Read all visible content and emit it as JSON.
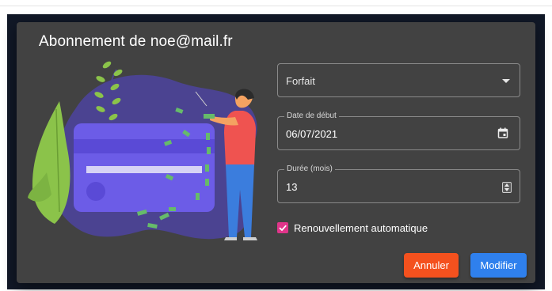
{
  "dialog": {
    "title": "Abonnement de noe@mail.fr"
  },
  "form": {
    "plan": {
      "placeholder": "Forfait",
      "icon": "chevron-down-icon"
    },
    "start_date": {
      "label": "Date de début",
      "value": "06/07/2021",
      "icon": "calendar-icon"
    },
    "duration": {
      "label": "Durée (mois)",
      "value": "13",
      "icon": "spinner-icon"
    },
    "auto_renew": {
      "label": "Renouvellement automatique",
      "checked": true
    }
  },
  "actions": {
    "cancel_label": "Annuler",
    "submit_label": "Modifier"
  },
  "colors": {
    "dialog_bg": "#424242",
    "backdrop": "#111827",
    "cancel": "#f4511e",
    "submit": "#2f80ed",
    "checkbox": "#e0358a",
    "card": "#6c5ce7",
    "blob": "#4b4391",
    "plant": "#8bc34a"
  }
}
